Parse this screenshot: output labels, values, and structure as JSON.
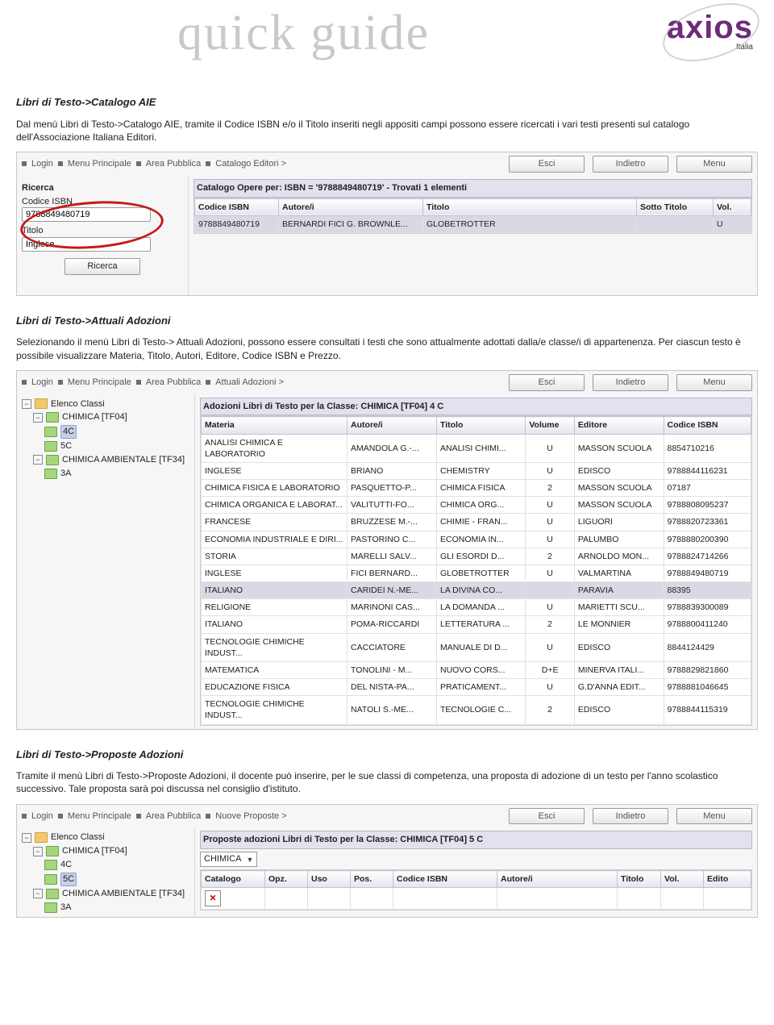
{
  "header": {
    "quick_guide": "quick guide",
    "brand": "axios",
    "brand_sub": "Italia"
  },
  "s1": {
    "title": "Libri di Testo->Catalogo AIE",
    "p1": "Dal menù Libri di Testo->Catalogo AIE, tramite il Codice ISBN e/o il Titolo inseriti negli appositi campi possono essere ricercati i vari testi presenti sul catalogo dell'Associazione Italiana Editori.",
    "crumbs": [
      "Login",
      "Menu Principale",
      "Area Pubblica",
      "Catalogo Editori >"
    ],
    "buttons": {
      "esci": "Esci",
      "indietro": "Indietro",
      "menu": "Menu"
    },
    "ricerca_label": "Ricerca",
    "codice_label": "Codice ISBN",
    "codice_value": "9788849480719",
    "titolo_label": "Titolo",
    "titolo_value": "Inglese",
    "ricerca_btn": "Ricerca",
    "grid_title": "Catalogo Opere per: ISBN = '9788849480719' - Trovati 1 elementi",
    "cols": {
      "isbn": "Codice ISBN",
      "autore": "Autore/i",
      "titolo": "Titolo",
      "sotto": "Sotto Titolo",
      "vol": "Vol."
    },
    "row": {
      "isbn": "9788849480719",
      "autore": "BERNARDI FICI G. BROWNLE...",
      "titolo": "GLOBETROTTER",
      "sotto": "",
      "vol": "U"
    }
  },
  "s2": {
    "title": "Libri di Testo->Attuali Adozioni",
    "p1": "Selezionando il menù Libri di Testo-> Attuali Adozioni,  possono essere consultati i testi che sono attualmente adottati dalla/e classe/i di appartenenza. Per ciascun testo è possibile visualizzare Materia, Titolo, Autori, Editore, Codice ISBN e Prezzo.",
    "crumbs": [
      "Login",
      "Menu Principale",
      "Area Pubblica",
      "Attuali Adozioni >"
    ],
    "buttons": {
      "esci": "Esci",
      "indietro": "Indietro",
      "menu": "Menu"
    },
    "tree": {
      "root": "Elenco Classi",
      "n1": "CHIMICA [TF04]",
      "n1a": "4C",
      "n1b": "5C",
      "n2": "CHIMICA AMBIENTALE [TF34]",
      "n2a": "3A"
    },
    "grid_title": "Adozioni Libri di Testo per la Classe: CHIMICA [TF04] 4 C",
    "cols": {
      "materia": "Materia",
      "autore": "Autore/i",
      "titolo": "Titolo",
      "vol": "Volume",
      "editore": "Editore",
      "isbn": "Codice ISBN"
    },
    "rows": [
      {
        "m": "ANALISI CHIMICA E LABORATORIO",
        "a": "AMANDOLA G.-...",
        "t": "ANALISI CHIMI...",
        "v": "U",
        "e": "MASSON SCUOLA",
        "i": "8854710216"
      },
      {
        "m": "INGLESE",
        "a": "BRIANO",
        "t": "CHEMISTRY",
        "v": "U",
        "e": "EDISCO",
        "i": "9788844116231"
      },
      {
        "m": "CHIMICA FISICA E LABORATORIO",
        "a": "PASQUETTO-P...",
        "t": "CHIMICA FISICA",
        "v": "2",
        "e": "MASSON SCUOLA",
        "i": "07187"
      },
      {
        "m": "CHIMICA ORGANICA E LABORAT...",
        "a": "VALITUTTI-FO...",
        "t": "CHIMICA ORG...",
        "v": "U",
        "e": "MASSON SCUOLA",
        "i": "9788808095237"
      },
      {
        "m": "FRANCESE",
        "a": "BRUZZESE M.-...",
        "t": "CHIMIE - FRAN...",
        "v": "U",
        "e": "LIGUORI",
        "i": "9788820723361"
      },
      {
        "m": "ECONOMIA INDUSTRIALE E DIRI...",
        "a": "PASTORINO C...",
        "t": "ECONOMIA IN...",
        "v": "U",
        "e": "PALUMBO",
        "i": "9788880200390"
      },
      {
        "m": "STORIA",
        "a": "MARELLI SALV...",
        "t": "GLI ESORDI D...",
        "v": "2",
        "e": "ARNOLDO MON...",
        "i": "9788824714266"
      },
      {
        "m": "INGLESE",
        "a": "FICI BERNARD...",
        "t": "GLOBETROTTER",
        "v": "U",
        "e": "VALMARTINA",
        "i": "9788849480719"
      },
      {
        "m": "ITALIANO",
        "a": "CARIDEI N.-ME...",
        "t": "LA DIVINA CO...",
        "v": "",
        "e": "PARAVIA",
        "i": "88395"
      },
      {
        "m": "RELIGIONE",
        "a": "MARINONI CAS...",
        "t": "LA DOMANDA ...",
        "v": "U",
        "e": "MARIETTI SCU...",
        "i": "9788839300089"
      },
      {
        "m": "ITALIANO",
        "a": "POMA-RICCARDI",
        "t": "LETTERATURA ...",
        "v": "2",
        "e": "LE MONNIER",
        "i": "9788800411240"
      },
      {
        "m": "TECNOLOGIE CHIMICHE INDUST...",
        "a": "CACCIATORE",
        "t": "MANUALE DI D...",
        "v": "U",
        "e": "EDISCO",
        "i": "8844124429"
      },
      {
        "m": "MATEMATICA",
        "a": "TONOLINI - M...",
        "t": "NUOVO CORS...",
        "v": "D+E",
        "e": "MINERVA ITALI...",
        "i": "9788829821860"
      },
      {
        "m": "EDUCAZIONE FISICA",
        "a": "DEL NISTA-PA...",
        "t": "PRATICAMENT...",
        "v": "U",
        "e": "G.D'ANNA EDIT...",
        "i": "9788881046645"
      },
      {
        "m": "TECNOLOGIE CHIMICHE INDUST...",
        "a": "NATOLI S.-ME...",
        "t": "TECNOLOGIE C...",
        "v": "2",
        "e": "EDISCO",
        "i": "9788844115319"
      }
    ],
    "selidx": 8
  },
  "s3": {
    "title": "Libri di Testo->Proposte Adozioni",
    "p1": "Tramite il menù Libri di Testo->Proposte Adozioni, il docente può inserire, per le sue classi di competenza, una proposta di adozione di un testo per l'anno scolastico successivo. Tale proposta sarà poi discussa nel consiglio d'istituto.",
    "crumbs": [
      "Login",
      "Menu Principale",
      "Area Pubblica",
      "Nuove Proposte >"
    ],
    "buttons": {
      "esci": "Esci",
      "indietro": "Indietro",
      "menu": "Menu"
    },
    "tree": {
      "root": "Elenco Classi",
      "n1": "CHIMICA [TF04]",
      "n1a": "4C",
      "n1b": "5C",
      "n2": "CHIMICA AMBIENTALE [TF34]",
      "n2a": "3A"
    },
    "grid_title": "Proposte adozioni Libri di Testo per la Classe: CHIMICA [TF04] 5 C",
    "dropdown": "CHIMICA",
    "cols": {
      "cat": "Catalogo",
      "opz": "Opz.",
      "uso": "Uso",
      "pos": "Pos.",
      "isbn": "Codice ISBN",
      "autore": "Autore/i",
      "titolo": "Titolo",
      "vol": "Vol.",
      "editore": "Edito"
    }
  }
}
